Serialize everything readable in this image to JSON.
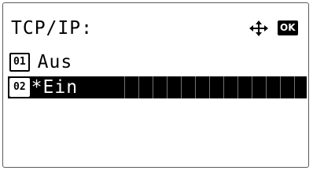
{
  "screen": {
    "title": "TCP/IP:",
    "nav_icon": "four-way-arrow-icon",
    "ok_label": "OK"
  },
  "options": [
    {
      "number": "01",
      "label": "Aus",
      "selected": false
    },
    {
      "number": "02",
      "label": "*Ein",
      "selected": true
    }
  ]
}
